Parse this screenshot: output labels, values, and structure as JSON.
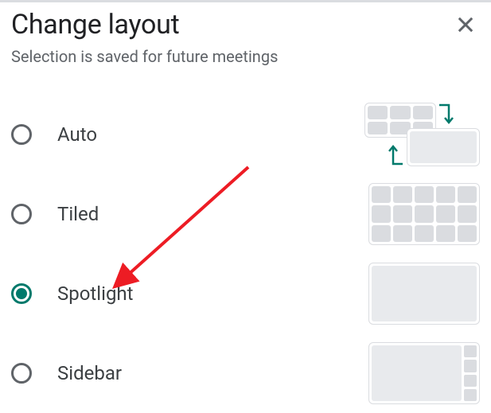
{
  "dialog": {
    "title": "Change layout",
    "subtitle": "Selection is saved for future meetings"
  },
  "options": [
    {
      "id": "auto",
      "label": "Auto",
      "selected": false
    },
    {
      "id": "tiled",
      "label": "Tiled",
      "selected": false
    },
    {
      "id": "spotlight",
      "label": "Spotlight",
      "selected": true
    },
    {
      "id": "sidebar",
      "label": "Sidebar",
      "selected": false
    }
  ],
  "colors": {
    "accent": "#00796b",
    "text_primary": "#202124",
    "text_secondary": "#5f6368",
    "border": "#dadce0",
    "tile_bg": "#e8eaed",
    "annotation": "#ed1c24"
  }
}
